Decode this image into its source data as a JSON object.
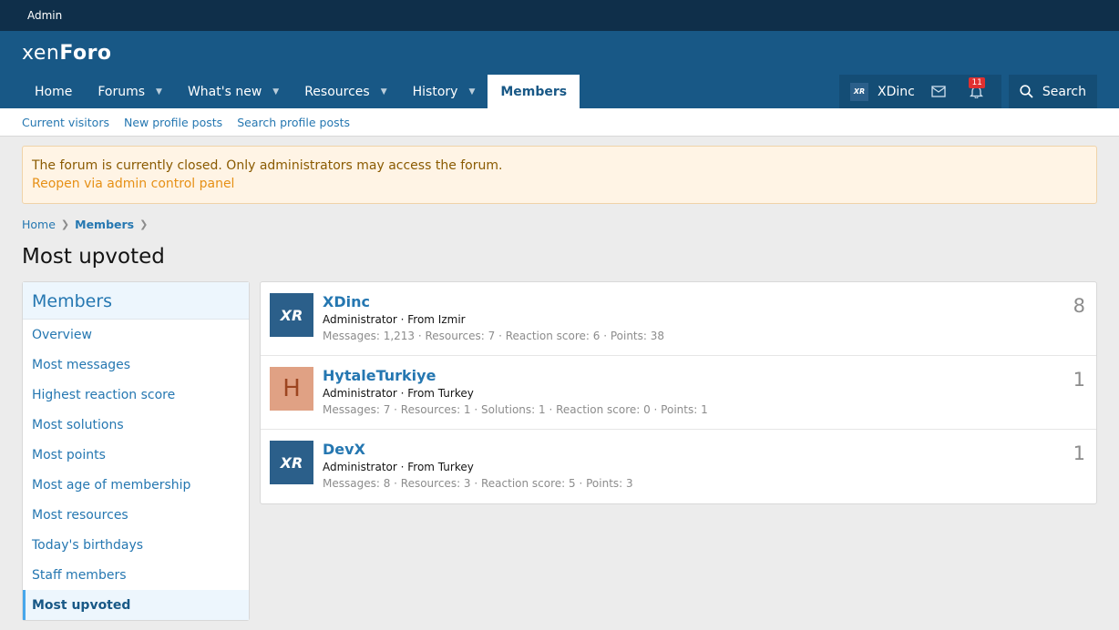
{
  "adminbar": {
    "label": "Admin"
  },
  "logo": {
    "part1": "xen",
    "part2": "Foro"
  },
  "nav": {
    "tabs": [
      {
        "label": "Home",
        "dropdown": false,
        "active": false
      },
      {
        "label": "Forums",
        "dropdown": true,
        "active": false
      },
      {
        "label": "What's new",
        "dropdown": true,
        "active": false
      },
      {
        "label": "Resources",
        "dropdown": true,
        "active": false
      },
      {
        "label": "History",
        "dropdown": true,
        "active": false
      },
      {
        "label": "Members",
        "dropdown": false,
        "active": true
      }
    ],
    "user": {
      "name": "XDinc",
      "avatar_text": "XR"
    },
    "alerts_count": "11",
    "search_label": "Search"
  },
  "subnav": [
    "Current visitors",
    "New profile posts",
    "Search profile posts"
  ],
  "notice": {
    "message": "The forum is currently closed. Only administrators may access the forum.",
    "link": "Reopen via admin control panel"
  },
  "breadcrumb": {
    "home": "Home",
    "section": "Members"
  },
  "page_title": "Most upvoted",
  "sidebar": {
    "title": "Members",
    "items": [
      "Overview",
      "Most messages",
      "Highest reaction score",
      "Most solutions",
      "Most points",
      "Most age of membership",
      "Most resources",
      "Today's birthdays",
      "Staff members",
      "Most upvoted"
    ],
    "active_index": 9
  },
  "members": [
    {
      "name": "XDinc",
      "avatar": "XR",
      "avatar_type": "xr",
      "title": "Administrator · From Izmir",
      "stats": "Messages: 1,213 · Resources: 7 · Reaction score: 6 · Points: 38",
      "score": "8"
    },
    {
      "name": "HytaleTurkiye",
      "avatar": "H",
      "avatar_type": "h",
      "title": "Administrator · From Turkey",
      "stats": "Messages: 7 · Resources: 1 · Solutions: 1 · Reaction score: 0 · Points: 1",
      "score": "1"
    },
    {
      "name": "DevX",
      "avatar": "XR",
      "avatar_type": "xr",
      "title": "Administrator · From Turkey",
      "stats": "Messages: 8 · Resources: 3 · Reaction score: 5 · Points: 3",
      "score": "1"
    }
  ]
}
